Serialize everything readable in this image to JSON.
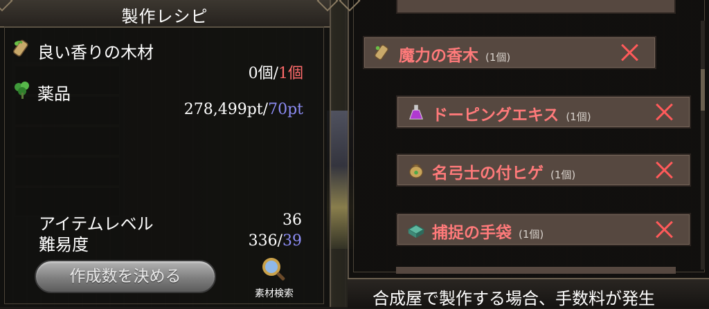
{
  "left_panel": {
    "title": "製作レシピ",
    "materials": [
      {
        "name": "良い香りの木材",
        "icon": "wood-icon",
        "have": "0個",
        "separator": "/",
        "need": "1個",
        "need_color": "#ff6b6b"
      },
      {
        "name": "薬品",
        "icon": "herb-icon",
        "have": "278,499pt",
        "separator": "/",
        "need": "70pt",
        "need_color": "#8d8df5"
      }
    ],
    "stats": {
      "item_level_label": "アイテムレベル",
      "item_level_value": "36",
      "difficulty_label": "難易度",
      "difficulty_have": "336",
      "difficulty_separator": "/",
      "difficulty_need": "39"
    },
    "make_button_label": "作成数を決める",
    "search_label": "素材検索"
  },
  "right_panel": {
    "recipes": [
      {
        "name": "魔力の香木",
        "qty": "(1個)",
        "icon": "wood-icon"
      },
      {
        "name": "ドーピングエキス",
        "qty": "(1個)",
        "icon": "potion-icon"
      },
      {
        "name": "名弓士の付ヒゲ",
        "qty": "(1個)",
        "icon": "pouch-icon"
      },
      {
        "name": "捕捉の手袋",
        "qty": "(1個)",
        "icon": "box-icon"
      }
    ],
    "footer_text": "合成屋で製作する場合、手数料が発生"
  },
  "colors": {
    "accent_red": "#ff7a7a",
    "accent_blue": "#8d8df5",
    "remove_x": "#ff5a5a",
    "row_bg": "#564840"
  }
}
